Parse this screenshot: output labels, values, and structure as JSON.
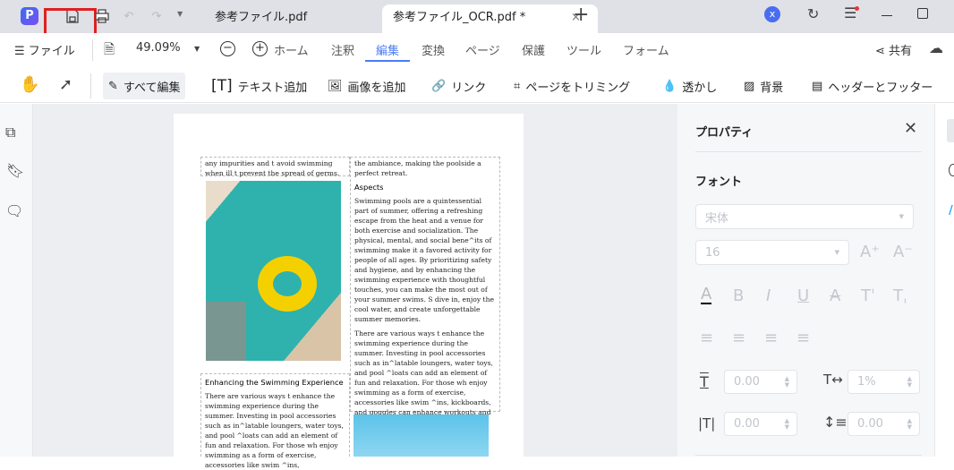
{
  "titlebar": {
    "tabs": [
      {
        "label": "参考ファイル.pdf"
      },
      {
        "label": "参考ファイル_OCR.pdf *"
      }
    ],
    "new_tab": "+",
    "user_initial": "x"
  },
  "menubar": {
    "file": "ファイル",
    "zoom": "49.09%",
    "items": [
      "ホーム",
      "注釈",
      "編集",
      "変換",
      "ページ",
      "保護",
      "ツール",
      "フォーム"
    ],
    "active": "編集",
    "share": "共有"
  },
  "toolbar": {
    "items": [
      "すべて編集",
      "テキスト追加",
      "画像を追加",
      "リンク",
      "ページをトリミング",
      "透かし",
      "背景",
      "ヘッダーとフッター"
    ]
  },
  "document": {
    "box1": "any impurities and t    avoid swimming when ill t    prevent the spread of germs.",
    "box2": "the ambiance, making the poolside a perfect retreat.",
    "aspects_heading": "Aspects",
    "aspects_p1": "Swimming pools are a quintessential part of summer, offering a refreshing escape from the heat and a venue for both exercise and socialization. The physical, mental, and social bene^its of swimming make it a favored activity for people of all ages. By prioritizing safety and hygiene, and by enhancing the swimming experience with thoughtful touches, you can make the most out of your summer swims. S    dive in, enjoy the cool water, and create unforgettable summer memories.",
    "aspects_p2": "There are various ways t    enhance the swimming experience during the summer. Investing in pool accessories such as in^latable loungers, water toys, and pool ^loats can add an element of fun and relaxation. For those wh    enjoy swimming as a form of exercise, accessories like swim ^ins, kickboards, and goggles can enhance workouts and improve technique.",
    "enh_heading": "Enhancing the Swimming Experience",
    "enh_p": "There are various ways t    enhance the swimming experience during the summer. Investing in pool accessories such as in^latable loungers, water toys, and pool ^loats can add an element of fun and relaxation. For those wh    enjoy swimming as a form of exercise, accessories like swim ^ins,"
  },
  "panel": {
    "title": "プロパティ",
    "font_section": "フォント",
    "font_family": "宋体",
    "font_size": "16",
    "char_spacing": "0.00",
    "scale": "1%",
    "word_spacing": "0.00",
    "line_spacing": "0.00"
  },
  "colors": {
    "accent": "#4a7cf6",
    "highlight": "#e02020"
  }
}
